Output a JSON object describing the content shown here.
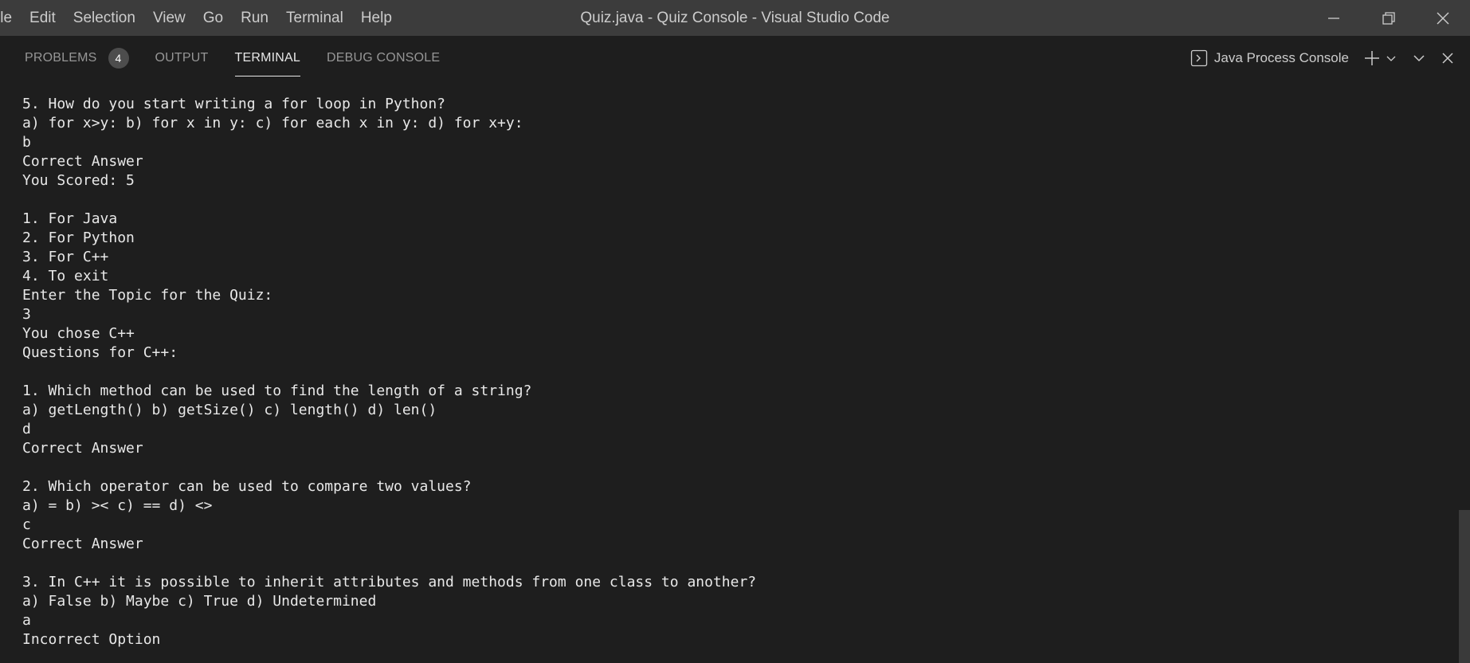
{
  "window": {
    "title": "Quiz.java - Quiz Console - Visual Studio Code"
  },
  "menu": {
    "items": [
      "ile",
      "Edit",
      "Selection",
      "View",
      "Go",
      "Run",
      "Terminal",
      "Help"
    ]
  },
  "panel": {
    "tabs": [
      {
        "label": "PROBLEMS",
        "badge": "4"
      },
      {
        "label": "OUTPUT"
      },
      {
        "label": "TERMINAL"
      },
      {
        "label": "DEBUG CONSOLE"
      }
    ],
    "active_tab": "TERMINAL",
    "console_selector": "Java Process Console"
  },
  "terminal": {
    "lines": [
      "5. How do you start writing a for loop in Python?",
      "a) for x>y: b) for x in y: c) for each x in y: d) for x+y:",
      "b",
      "Correct Answer",
      "You Scored: 5",
      "",
      "1. For Java",
      "2. For Python",
      "3. For C++",
      "4. To exit",
      "Enter the Topic for the Quiz:",
      "3",
      "You chose C++",
      "Questions for C++:",
      "",
      "1. Which method can be used to find the length of a string?",
      "a) getLength() b) getSize() c) length() d) len()",
      "d",
      "Correct Answer",
      "",
      "2. Which operator can be used to compare two values?",
      "a) = b) >< c) == d) <>",
      "c",
      "Correct Answer",
      "",
      "3. In C++ it is possible to inherit attributes and methods from one class to another?",
      "a) False b) Maybe c) True d) Undetermined",
      "a",
      "Incorrect Option"
    ]
  },
  "icons": {
    "minimize": "minimize-icon",
    "restore": "restore-icon",
    "close": "close-icon",
    "console": "terminal-icon",
    "add": "plus-icon",
    "dropdown": "chevron-down-icon",
    "collapse": "chevron-down-icon",
    "kill": "close-icon"
  },
  "colors": {
    "titlebar": "#3c3c3c",
    "background": "#1e1e1e",
    "text": "#cccccc",
    "terminal_text": "#e8e8e8",
    "badge": "#4d4d4d"
  }
}
